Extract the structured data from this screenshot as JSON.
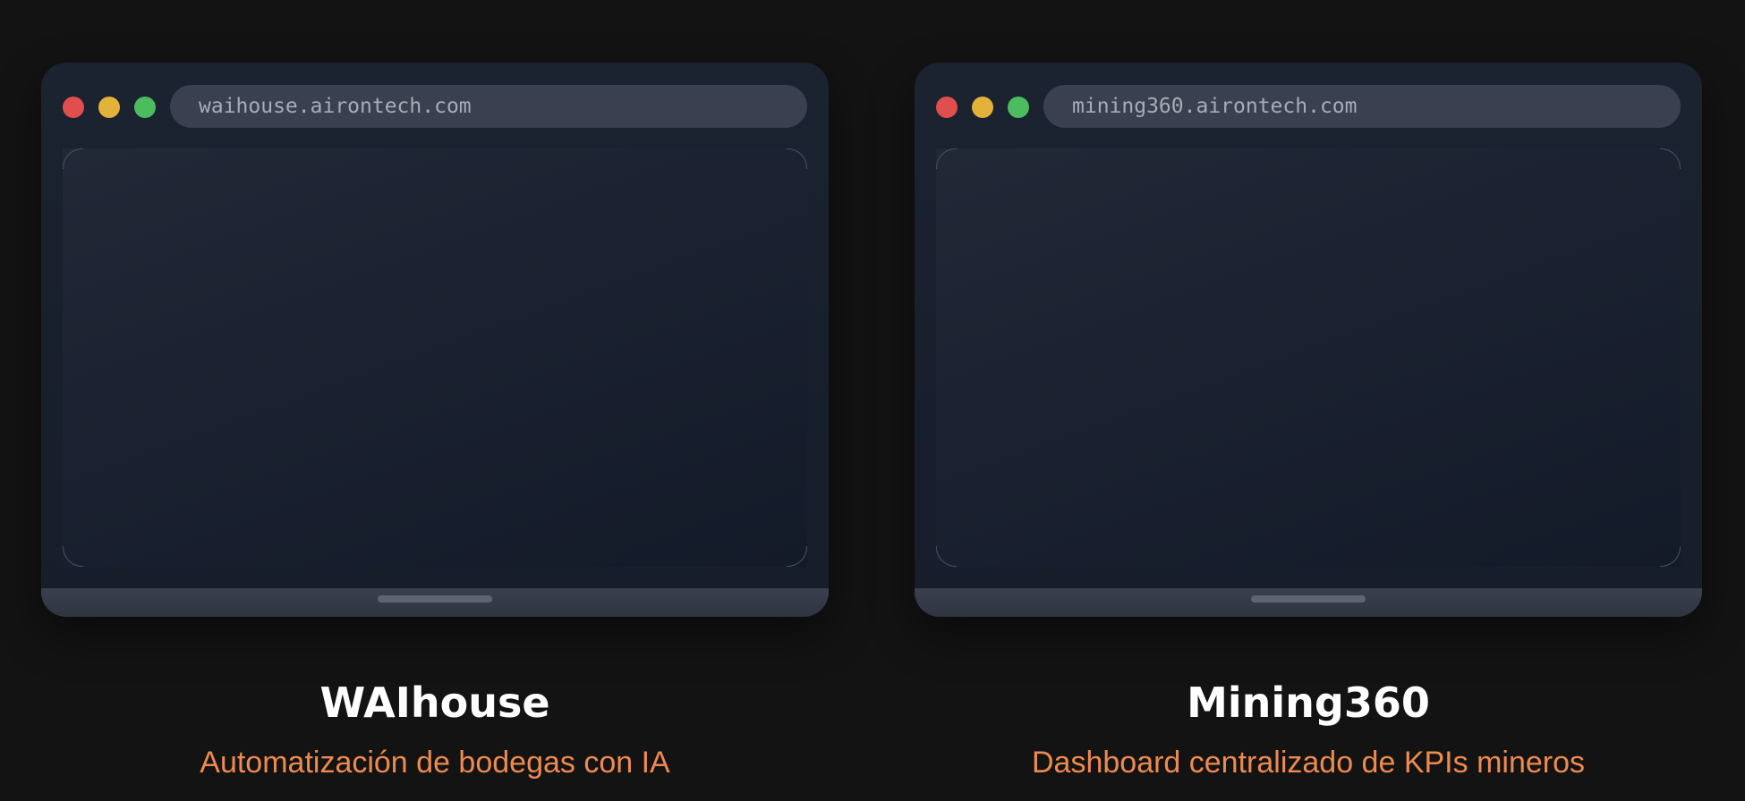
{
  "colors": {
    "background": "#131313",
    "accent": "#ee8a4f",
    "title": "#ffffff",
    "traffic_red": "#e04e4e",
    "traffic_yellow": "#e2b23a",
    "traffic_green": "#4cbd5e"
  },
  "projects": [
    {
      "url": "waihouse.airontech.com",
      "title": "WAIhouse",
      "subtitle": "Automatización de bodegas con IA"
    },
    {
      "url": "mining360.airontech.com",
      "title": "Mining360",
      "subtitle": "Dashboard centralizado de KPIs mineros"
    }
  ]
}
